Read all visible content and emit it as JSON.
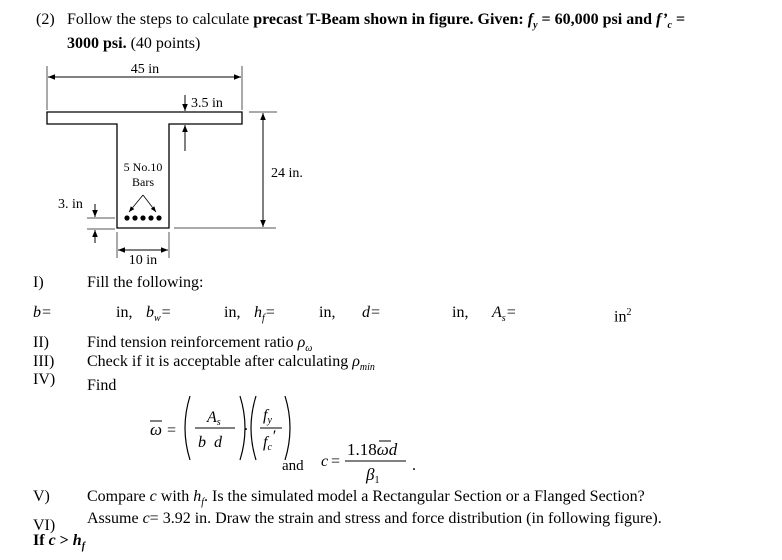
{
  "question": {
    "number": "(2)",
    "intro_plain": "Follow the steps to calculate",
    "intro_bold": "precast T-Beam shown in figure. Given:",
    "fy_symbol": "f",
    "fy_sub": "y",
    "fy_value": "= 60,000 psi and",
    "fc_symbol": "f’",
    "fc_sub": "c",
    "fc_eq": "=",
    "fc_value": "3000 psi.",
    "points": "(40 points)"
  },
  "figure": {
    "flange_width_label": "45 in",
    "flange_thickness_label": "3.5 in",
    "total_height_label": "24 in.",
    "bars_label_line1": "5 No.10",
    "bars_label_line2": "Bars",
    "cover_label": "3. in",
    "web_width_label": "10 in",
    "bar_count": 5
  },
  "steps": {
    "s1": {
      "num": "I)",
      "text": "Fill the following:"
    },
    "fill": {
      "b": "b=",
      "in1": "in,",
      "bw_sym": "b",
      "bw_sub": "w",
      "bw_eq": "=",
      "in2": "in,",
      "hf_sym": "h",
      "hf_sub": "f",
      "hf_eq": "=",
      "in3": "in,",
      "d": "d=",
      "in4": "in,",
      "As_sym": "A",
      "As_sub": "s",
      "As_eq": "=",
      "unit": "in",
      "unit_sup": "2"
    },
    "s2": {
      "num": "II)",
      "text": "Find tension reinforcement ratio",
      "sym": "ρ",
      "sub": "ω"
    },
    "s3": {
      "num": "III)",
      "text": "Check if it is acceptable after calculating",
      "sym": "ρ",
      "sub": "min"
    },
    "s4": {
      "num": "IV)",
      "text": "Find"
    },
    "formula": {
      "omega": "ω",
      "eq": "=",
      "num1": "A",
      "num1_sub": "s",
      "den1": "b  d",
      "dot": ".",
      "num2": "f",
      "num2_sub": "y",
      "den2": "f",
      "den2_sub": "c",
      "den2_prime": "′",
      "and": "and",
      "c": "c",
      "c_eq": "=",
      "c_num": "1.18",
      "c_num_omega": "ω",
      "c_num_d": "d",
      "c_den": "β",
      "c_den_sub": "1",
      "period": "."
    },
    "s5": {
      "num": "V)",
      "text_a": "Compare",
      "c": "c",
      "text_b": "with",
      "hf": "h",
      "hf_sub": "f",
      "text_c": ". Is the simulated model a Rectangular Section or a Flanged Section?"
    },
    "s6": {
      "num": "VI)",
      "text_a": "Assume",
      "c": "c",
      "text_b": "= 3.92 in. Draw the strain and stress and force distribution (in following figure)."
    },
    "condition": {
      "if": "If",
      "c": "c",
      "gt": ">",
      "h": "h",
      "sub": "f"
    }
  }
}
